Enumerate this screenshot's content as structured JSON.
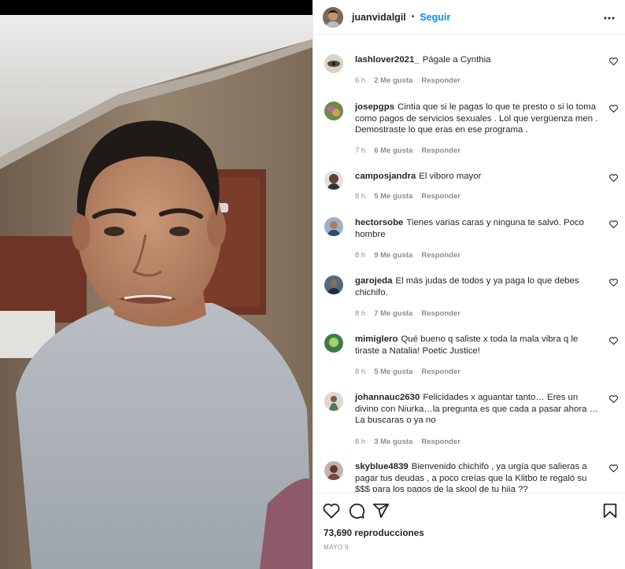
{
  "post": {
    "username": "juanvidalgil",
    "separator": "•",
    "follow_label": "Seguir",
    "more_label": "•••",
    "views": "73,690 reproducciones",
    "date": "MAYO 9"
  },
  "comments": [
    {
      "user": "lashlover2021_",
      "text": "Págale a Cynthia",
      "time": "6 h",
      "likes": "2 Me gusta",
      "reply": "Responder"
    },
    {
      "user": "josepgps",
      "text": "Cintia que si le pagas lo que te presto o si lo toma como pagos de servicios sexuales . Lol que vergüenza men . Demostraste lo que eras en ese programa .",
      "time": "7 h",
      "likes": "6 Me gusta",
      "reply": "Responder"
    },
    {
      "user": "camposjandra",
      "text": "El viboro mayor",
      "time": "8 h",
      "likes": "5 Me gusta",
      "reply": "Responder"
    },
    {
      "user": "hectorsobe",
      "text": "Tienes varias caras y ninguna te salvó. Poco hombre",
      "time": "8 h",
      "likes": "9 Me gusta",
      "reply": "Responder"
    },
    {
      "user": "garojeda",
      "text": "El más judas de todos y ya paga lo que debes chichifo.",
      "time": "8 h",
      "likes": "7 Me gusta",
      "reply": "Responder"
    },
    {
      "user": "mimiglero",
      "text": "Qué bueno q saliste x toda la mala vibra q le tiraste a Natalia! Poetic Justice!",
      "time": "8 h",
      "likes": "5 Me gusta",
      "reply": "Responder"
    },
    {
      "user": "johannauc2630",
      "text": "Felicidades x aguantar tanto… Eres un divino con Niurka…la pregunta es que cada a pasar ahora … La buscaras o ya no",
      "time": "8 h",
      "likes": "3 Me gusta",
      "reply": "Responder"
    },
    {
      "user": "skyblue4839",
      "text": "Bienvenido chichifo , ya urgía que salieras a pagar tus deudas , a poco creías que la Klitbo te regaló su $$$ para los pagos de la skool de tu hija ??",
      "time": "",
      "likes": "",
      "reply": ""
    }
  ],
  "icons": {
    "like": "heart-icon",
    "comment": "comment-icon",
    "share": "share-icon",
    "save": "bookmark-icon",
    "more": "more-horizontal-icon"
  },
  "colors": {
    "follow": "#0095f6",
    "meta": "#8e8e8e",
    "text": "#262626"
  }
}
